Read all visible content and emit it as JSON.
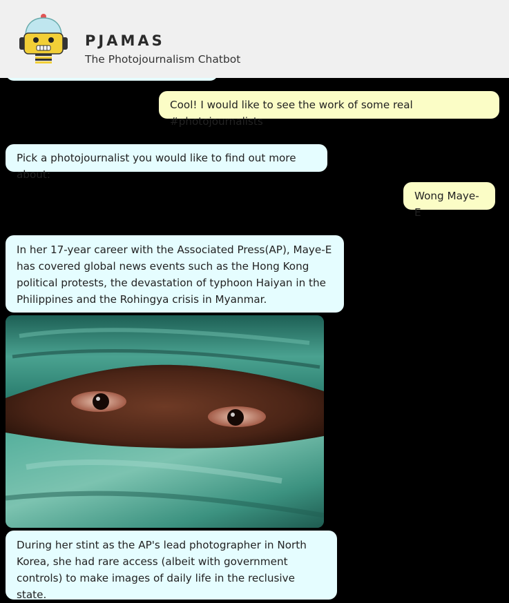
{
  "header": {
    "title": "PJAMAS",
    "subtitle": "The Photojournalism Chatbot",
    "logo_icon": "robot-icon"
  },
  "messages": [
    {
      "sender": "user",
      "text": "Cool! I would like to see the work of some real #photojournalists"
    },
    {
      "sender": "bot",
      "text": "Pick a photojournalist you would like to find out more about:"
    },
    {
      "sender": "user",
      "text": "Wong Maye-E"
    },
    {
      "sender": "bot",
      "text": "In her 17-year career with the Associated Press(AP), Maye-E has covered global news events such as the Hong Kong political protests, the devastation of typhoon Haiyan in the Philippines and the Rohingya crisis in Myanmar."
    },
    {
      "sender": "bot",
      "type": "image",
      "subject": "woman-in-green-headscarf-photo"
    },
    {
      "sender": "bot",
      "text": "During her stint as the AP's lead photographer in North Korea, she had rare access (albeit with government controls) to make images of daily life in the reclusive state."
    }
  ],
  "colors": {
    "background": "#000000",
    "header_bg": "#f0f0f0",
    "bot_bubble": "#e5fdff",
    "user_bubble": "#fbfdc6"
  }
}
